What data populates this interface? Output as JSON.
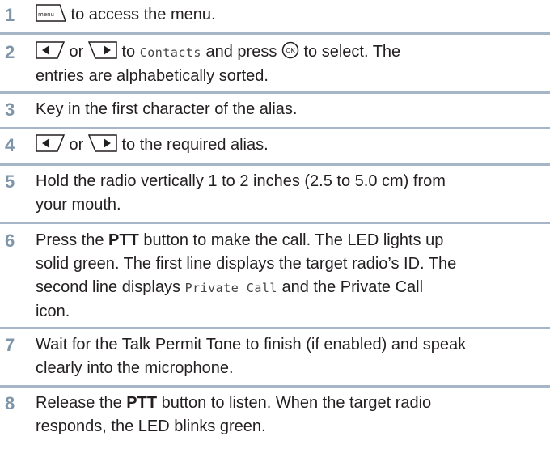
{
  "steps": [
    {
      "number": "1",
      "text_after_icon": " to access the menu.",
      "icon": "menu-key-icon"
    },
    {
      "number": "2",
      "or": " or ",
      "text_to": " to ",
      "contacts": "Contacts",
      "text_press": " and press ",
      "text_select_line1": " to select. The",
      "text_line2": "entries are alphabetically sorted."
    },
    {
      "number": "3",
      "text": "Key in the first character of the alias."
    },
    {
      "number": "4",
      "or": " or ",
      "text_after": " to the required alias."
    },
    {
      "number": "5",
      "text_line1": "Hold the radio vertically 1 to 2 inches (2.5 to 5.0 cm) from",
      "text_line2": "your mouth."
    },
    {
      "number": "6",
      "text_press": "Press the ",
      "ptt": "PTT",
      "text_line1_rest": " button to make the call. The LED lights up",
      "text_line2": "solid green. The first line displays the target radio’s ID. The",
      "text_line3_pre": "second line displays ",
      "private_call": "Private Call",
      "text_line3_post": " and the Private Call",
      "text_line4": "icon."
    },
    {
      "number": "7",
      "text_line1": "Wait for the Talk Permit Tone to finish (if enabled) and speak",
      "text_line2": "clearly into the microphone."
    },
    {
      "number": "8",
      "text_release": "Release the ",
      "ptt": "PTT",
      "text_line1_rest": " button to listen. When the target radio",
      "text_line2": "responds, the LED blinks green."
    }
  ],
  "colors": {
    "step_number": "#7f95aa",
    "separator": "#a6b6c7",
    "text": "#231f20"
  }
}
